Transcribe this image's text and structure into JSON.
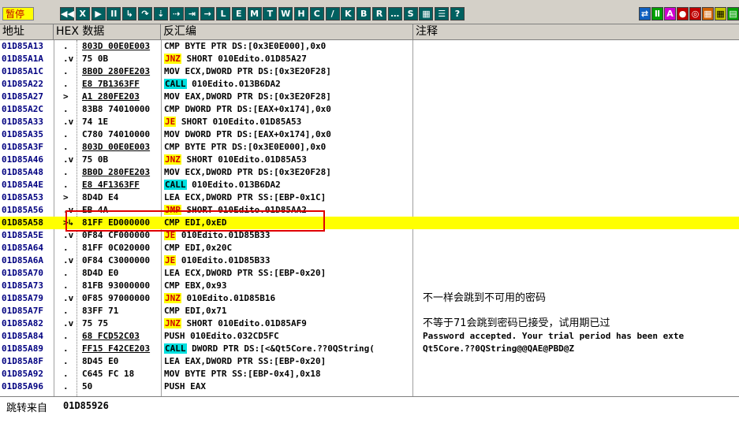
{
  "status": {
    "label": "暂停"
  },
  "toolbar": {
    "buttons": [
      {
        "icon": "rewind-icon",
        "glyph": "◀◀",
        "color": "dark"
      },
      {
        "icon": "close-icon",
        "glyph": "X",
        "color": "dark"
      },
      {
        "icon": "play-icon",
        "glyph": "▶",
        "color": "dark"
      },
      {
        "icon": "pause-icon",
        "glyph": "II",
        "color": "dark"
      },
      {
        "icon": "step-into-icon",
        "glyph": "↳",
        "color": "dark"
      },
      {
        "icon": "step-over-icon",
        "glyph": "↷",
        "color": "dark"
      },
      {
        "icon": "trace-into-icon",
        "glyph": "⇣",
        "color": "dark"
      },
      {
        "icon": "trace-over-icon",
        "glyph": "⇢",
        "color": "dark"
      },
      {
        "icon": "execute-till-return-icon",
        "glyph": "⇥",
        "color": "dark"
      },
      {
        "icon": "goto-icon",
        "glyph": "→",
        "color": "dark"
      },
      {
        "icon": "window-l-icon",
        "glyph": "L",
        "color": "dark"
      },
      {
        "icon": "window-e-icon",
        "glyph": "E",
        "color": "dark"
      },
      {
        "icon": "window-m-icon",
        "glyph": "M",
        "color": "dark"
      },
      {
        "icon": "window-t-icon",
        "glyph": "T",
        "color": "dark"
      },
      {
        "icon": "window-w-icon",
        "glyph": "W",
        "color": "dark"
      },
      {
        "icon": "window-h-icon",
        "glyph": "H",
        "color": "dark"
      },
      {
        "icon": "window-c-icon",
        "glyph": "C",
        "color": "dark"
      },
      {
        "icon": "window-slash-icon",
        "glyph": "/",
        "color": "dark"
      },
      {
        "icon": "window-k-icon",
        "glyph": "K",
        "color": "dark"
      },
      {
        "icon": "window-b-icon",
        "glyph": "B",
        "color": "dark"
      },
      {
        "icon": "window-r-icon",
        "glyph": "R",
        "color": "dark"
      },
      {
        "icon": "window-dots-icon",
        "glyph": "…",
        "color": "dark"
      },
      {
        "icon": "window-s-icon",
        "glyph": "S",
        "color": "dark"
      },
      {
        "icon": "grid-icon",
        "glyph": "▦",
        "color": "dark"
      },
      {
        "icon": "options-icon",
        "glyph": "☰",
        "color": "dark"
      },
      {
        "icon": "help-icon",
        "glyph": "?",
        "color": "dark"
      }
    ],
    "right_buttons": [
      {
        "icon": "switch-icon",
        "glyph": "⇄",
        "color": "blue"
      },
      {
        "icon": "plugin-icon",
        "glyph": "Ⅱ",
        "color": "green"
      },
      {
        "icon": "letter-a-icon",
        "glyph": "A",
        "color": "pink"
      },
      {
        "icon": "record-icon",
        "glyph": "●",
        "color": "red"
      },
      {
        "icon": "target-icon",
        "glyph": "◎",
        "color": "red"
      },
      {
        "icon": "grid2-icon",
        "glyph": "▦",
        "color": "orange"
      },
      {
        "icon": "grid3-icon",
        "glyph": "▦",
        "color": "yellow"
      },
      {
        "icon": "cells-icon",
        "glyph": "▤",
        "color": "green"
      }
    ]
  },
  "columns": {
    "address": "地址",
    "hex": "HEX 数据",
    "disasm": "反汇编",
    "comment": "注释"
  },
  "rows": [
    {
      "addr": "01D85A13",
      "mark": ".",
      "hex": "803D 00E0E003",
      "hex_u": true,
      "mn": "",
      "mnc": "",
      "op": "CMP BYTE PTR DS:[0x3E0E000],0x0",
      "comment": ""
    },
    {
      "addr": "01D85A1A",
      "mark": ".v",
      "hex": "75 0B",
      "hex_u": false,
      "mn": "JNZ",
      "mnc": "jcc",
      "op": " SHORT 010Edito.01D85A27",
      "comment": ""
    },
    {
      "addr": "01D85A1C",
      "mark": ".",
      "hex": "8B0D 280FE203",
      "hex_u": true,
      "mn": "",
      "mnc": "",
      "op": "MOV ECX,DWORD PTR DS:[0x3E20F28]",
      "comment": ""
    },
    {
      "addr": "01D85A22",
      "mark": ".",
      "hex": "E8 7B1363FF",
      "hex_u": true,
      "mn": "CALL",
      "mnc": "call",
      "op": " 010Edito.013B6DA2",
      "comment": ""
    },
    {
      "addr": "01D85A27",
      "mark": ">",
      "hex": "A1 280FE203",
      "hex_u": true,
      "mn": "",
      "mnc": "",
      "op": "MOV EAX,DWORD PTR DS:[0x3E20F28]",
      "comment": ""
    },
    {
      "addr": "01D85A2C",
      "mark": ".",
      "hex": "83B8 74010000",
      "hex_u": false,
      "mn": "",
      "mnc": "",
      "op": "CMP DWORD PTR DS:[EAX+0x174],0x0",
      "comment": ""
    },
    {
      "addr": "01D85A33",
      "mark": ".v",
      "hex": "74 1E",
      "hex_u": false,
      "mn": "JE",
      "mnc": "jcc",
      "op": " SHORT 010Edito.01D85A53",
      "comment": ""
    },
    {
      "addr": "01D85A35",
      "mark": ".",
      "hex": "C780 74010000",
      "hex_u": false,
      "mn": "",
      "mnc": "",
      "op": "MOV DWORD PTR DS:[EAX+0x174],0x0",
      "comment": ""
    },
    {
      "addr": "01D85A3F",
      "mark": ".",
      "hex": "803D 00E0E003",
      "hex_u": true,
      "mn": "",
      "mnc": "",
      "op": "CMP BYTE PTR DS:[0x3E0E000],0x0",
      "comment": ""
    },
    {
      "addr": "01D85A46",
      "mark": ".v",
      "hex": "75 0B",
      "hex_u": false,
      "mn": "JNZ",
      "mnc": "jcc",
      "op": " SHORT 010Edito.01D85A53",
      "comment": ""
    },
    {
      "addr": "01D85A48",
      "mark": ".",
      "hex": "8B0D 280FE203",
      "hex_u": true,
      "mn": "",
      "mnc": "",
      "op": "MOV ECX,DWORD PTR DS:[0x3E20F28]",
      "comment": ""
    },
    {
      "addr": "01D85A4E",
      "mark": ".",
      "hex": "E8 4F1363FF",
      "hex_u": true,
      "mn": "CALL",
      "mnc": "call",
      "op": " 010Edito.013B6DA2",
      "comment": ""
    },
    {
      "addr": "01D85A53",
      "mark": ">",
      "hex": "8D4D E4",
      "hex_u": false,
      "mn": "",
      "mnc": "",
      "op": "LEA ECX,DWORD PTR SS:[EBP-0x1C]",
      "comment": ""
    },
    {
      "addr": "01D85A56",
      "mark": ".v",
      "hex": "EB 4A",
      "hex_u": false,
      "mn": "JMP",
      "mnc": "jmp",
      "op": " SHORT 010Edito.01D85AA2",
      "comment": ""
    },
    {
      "addr": "01D85A58",
      "mark": ">↳",
      "hex": "81FF ED000000",
      "hex_u": false,
      "mn": "",
      "mnc": "",
      "op": "CMP EDI,0xED",
      "comment": "",
      "sel": true
    },
    {
      "addr": "01D85A5E",
      "mark": ".v",
      "hex": "0F84 CF000000",
      "hex_u": false,
      "mn": "JE",
      "mnc": "jcc",
      "op": " 010Edito.01D85B33",
      "comment": ""
    },
    {
      "addr": "01D85A64",
      "mark": ".",
      "hex": "81FF 0C020000",
      "hex_u": false,
      "mn": "",
      "mnc": "",
      "op": "CMP EDI,0x20C",
      "comment": ""
    },
    {
      "addr": "01D85A6A",
      "mark": ".v",
      "hex": "0F84 C3000000",
      "hex_u": false,
      "mn": "JE",
      "mnc": "jcc",
      "op": " 010Edito.01D85B33",
      "comment": ""
    },
    {
      "addr": "01D85A70",
      "mark": ".",
      "hex": "8D4D E0",
      "hex_u": false,
      "mn": "",
      "mnc": "",
      "op": "LEA ECX,DWORD PTR SS:[EBP-0x20]",
      "comment": ""
    },
    {
      "addr": "01D85A73",
      "mark": ".",
      "hex": "81FB 93000000",
      "hex_u": false,
      "mn": "",
      "mnc": "",
      "op": "CMP EBX,0x93",
      "comment": ""
    },
    {
      "addr": "01D85A79",
      "mark": ".v",
      "hex": "0F85 97000000",
      "hex_u": false,
      "mn": "JNZ",
      "mnc": "jcc",
      "op": " 010Edito.01D85B16",
      "comment": "不一样会跳到不可用的密码",
      "cn": true
    },
    {
      "addr": "01D85A7F",
      "mark": ".",
      "hex": "83FF 71",
      "hex_u": false,
      "mn": "",
      "mnc": "",
      "op": "CMP EDI,0x71",
      "comment": ""
    },
    {
      "addr": "01D85A82",
      "mark": ".v",
      "hex": "75 75",
      "hex_u": false,
      "mn": "JNZ",
      "mnc": "jcc",
      "op": " SHORT 010Edito.01D85AF9",
      "comment": "不等于71会跳到密码已接受，试用期已过",
      "cn": true
    },
    {
      "addr": "01D85A84",
      "mark": ".",
      "hex": "68 FCD52C03",
      "hex_u": true,
      "mn": "",
      "mnc": "",
      "op": "PUSH 010Edito.032CD5FC",
      "comment": "Password accepted. Your trial period has been exte"
    },
    {
      "addr": "01D85A89",
      "mark": ".",
      "hex": "FF15 F42CE203",
      "hex_u": true,
      "mn": "CALL",
      "mnc": "call",
      "op": " DWORD PTR DS:[<&Qt5Core.??0QString(",
      "comment": "Qt5Core.??0QString@@QAE@PBD@Z"
    },
    {
      "addr": "01D85A8F",
      "mark": ".",
      "hex": "8D45 E0",
      "hex_u": false,
      "mn": "",
      "mnc": "",
      "op": "LEA EAX,DWORD PTR SS:[EBP-0x20]",
      "comment": ""
    },
    {
      "addr": "01D85A92",
      "mark": ".",
      "hex": "C645 FC 18",
      "hex_u": false,
      "mn": "",
      "mnc": "",
      "op": "MOV BYTE PTR SS:[EBP-0x4],0x18",
      "comment": ""
    },
    {
      "addr": "01D85A96",
      "mark": ".",
      "hex": "50",
      "hex_u": false,
      "mn": "",
      "mnc": "",
      "op": "PUSH EAX",
      "comment": ""
    }
  ],
  "footer": {
    "label": "跳转来自",
    "value": "01D85926"
  }
}
